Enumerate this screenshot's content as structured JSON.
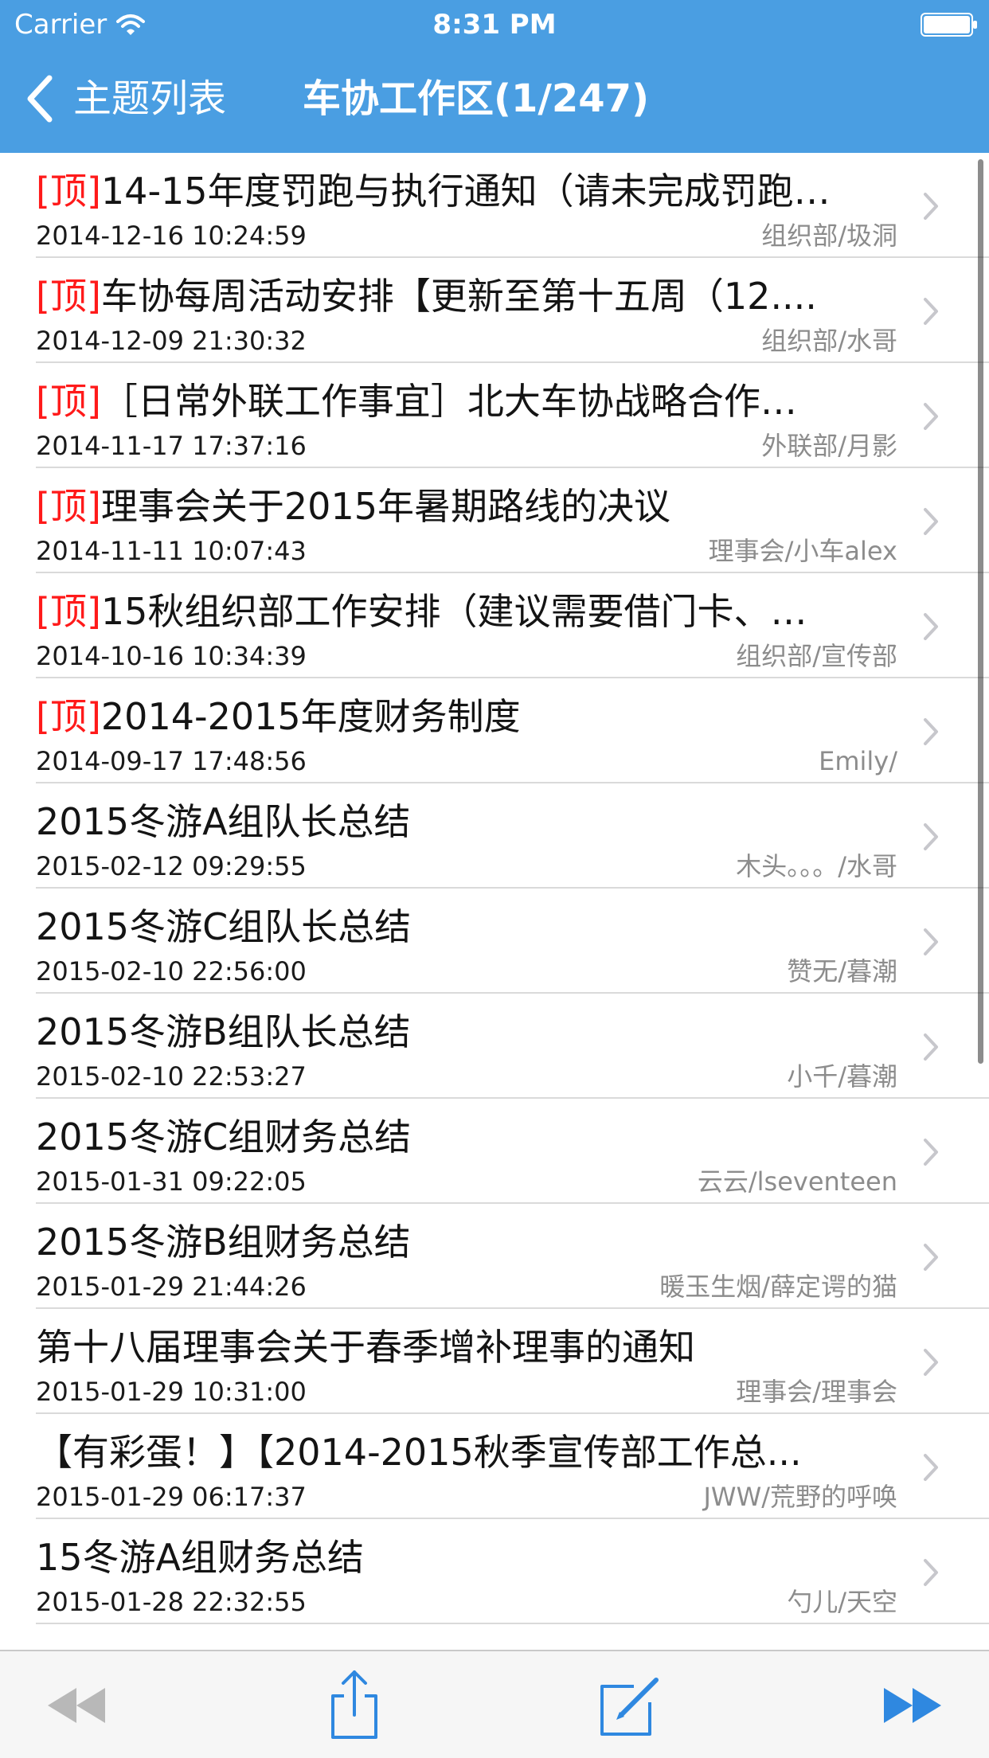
{
  "status_bar": {
    "carrier": "Carrier",
    "time": "8:31 PM"
  },
  "nav": {
    "back_label": "主题列表",
    "title": "车协工作区(1/247)"
  },
  "colors": {
    "nav_background": "#4a9ee2",
    "top_tag": "#ff1a1a",
    "toolbar_active": "#2f88e0",
    "toolbar_disabled": "#b8b8b8",
    "author_text": "#8c8c8c"
  },
  "topics": [
    {
      "tag": "[顶]",
      "title": "14-15年度罚跑与执行通知（请未完成罚跑…",
      "date": "2014-12-16 10:24:59",
      "author": "组织部/圾洞"
    },
    {
      "tag": "[顶]",
      "title": "车协每周活动安排【更新至第十五周（12....",
      "date": "2014-12-09 21:30:32",
      "author": "组织部/水哥"
    },
    {
      "tag": "[顶]",
      "title": "［日常外联工作事宜］北大车协战略合作…",
      "date": "2014-11-17 17:37:16",
      "author": "外联部/月影"
    },
    {
      "tag": "[顶]",
      "title": "理事会关于2015年暑期路线的决议",
      "date": "2014-11-11 10:07:43",
      "author": "理事会/小车alex"
    },
    {
      "tag": "[顶]",
      "title": "15秋组织部工作安排（建议需要借门卡、…",
      "date": "2014-10-16 10:34:39",
      "author": "组织部/宣传部"
    },
    {
      "tag": "[顶]",
      "title": "2014-2015年度财务制度",
      "date": "2014-09-17 17:48:56",
      "author": "Emily/"
    },
    {
      "tag": "",
      "title": "2015冬游A组队长总结",
      "date": "2015-02-12 09:29:55",
      "author": "木头。。。/水哥"
    },
    {
      "tag": "",
      "title": "2015冬游C组队长总结",
      "date": "2015-02-10 22:56:00",
      "author": "赞无/暮潮"
    },
    {
      "tag": "",
      "title": "2015冬游B组队长总结",
      "date": "2015-02-10 22:53:27",
      "author": "小千/暮潮"
    },
    {
      "tag": "",
      "title": "2015冬游C组财务总结",
      "date": "2015-01-31 09:22:05",
      "author": "云云/lseventeen"
    },
    {
      "tag": "",
      "title": "2015冬游B组财务总结",
      "date": "2015-01-29 21:44:26",
      "author": "暖玉生烟/薛定谔的猫"
    },
    {
      "tag": "",
      "title": "第十八届理事会关于春季增补理事的通知",
      "date": "2015-01-29 10:31:00",
      "author": "理事会/理事会"
    },
    {
      "tag": "",
      "title": "【有彩蛋！】【2014-2015秋季宣传部工作总...",
      "date": "2015-01-29 06:17:37",
      "author": "JWW/荒野的呼唤"
    },
    {
      "tag": "",
      "title": "15冬游A组财务总结",
      "date": "2015-01-28 22:32:55",
      "author": "勺儿/天空"
    }
  ],
  "toolbar": {
    "rewind_icon": "rewind-icon",
    "share_icon": "share-icon",
    "compose_icon": "compose-icon",
    "forward_icon": "fast-forward-icon"
  }
}
